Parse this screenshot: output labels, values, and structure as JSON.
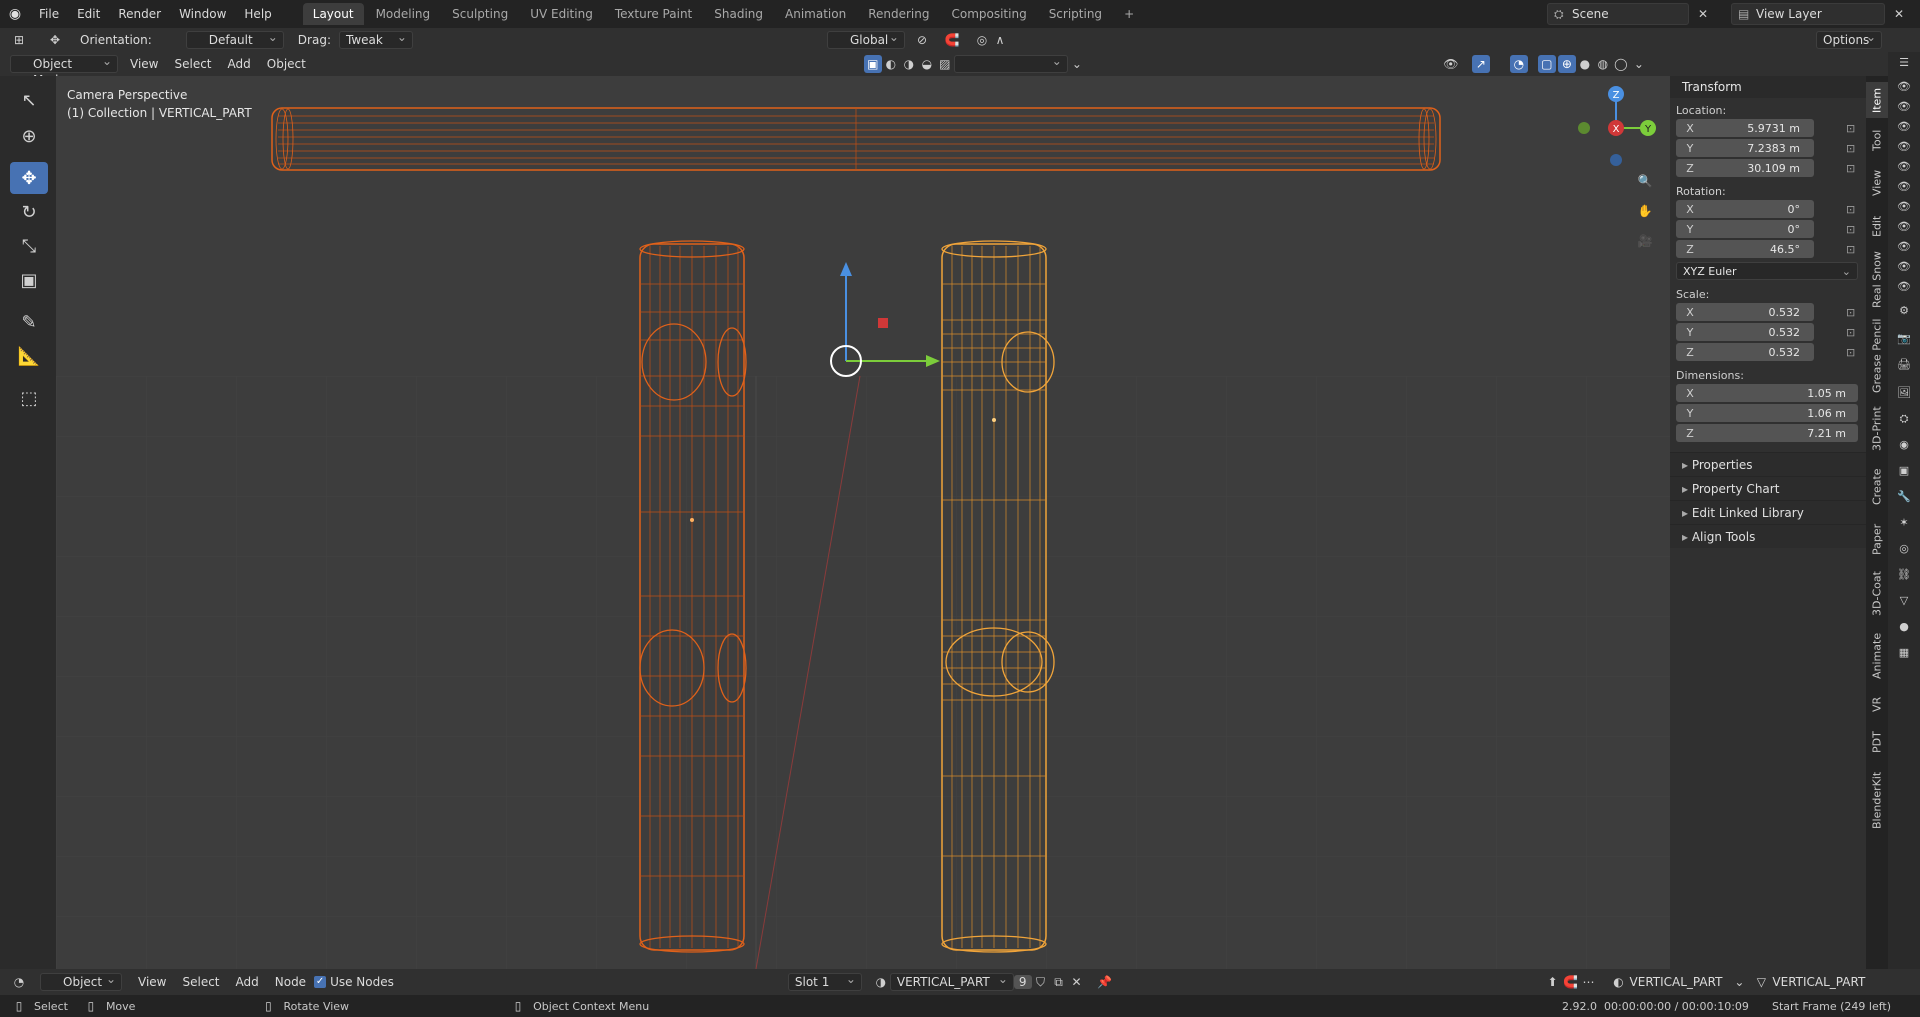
{
  "menu": {
    "file": "File",
    "edit": "Edit",
    "render": "Render",
    "window": "Window",
    "help": "Help"
  },
  "workspaces": [
    "Layout",
    "Modeling",
    "Sculpting",
    "UV Editing",
    "Texture Paint",
    "Shading",
    "Animation",
    "Rendering",
    "Compositing",
    "Scripting"
  ],
  "scene": {
    "name": "Scene",
    "view_layer": "View Layer"
  },
  "tool_header": {
    "orientation_label": "Orientation:",
    "orientation_value": "Default",
    "drag_label": "Drag:",
    "drag_value": "Tweak",
    "transform_orientation": "Global",
    "options": "Options"
  },
  "viewport_header": {
    "mode": "Object Mode",
    "view": "View",
    "select": "Select",
    "add": "Add",
    "object": "Object"
  },
  "viewport": {
    "perspective": "Camera Perspective",
    "collection": "(1) Collection | VERTICAL_PART"
  },
  "npanel": {
    "title": "Transform",
    "location_label": "Location:",
    "location": {
      "x": "5.9731 m",
      "y": "7.2383 m",
      "z": "30.109 m"
    },
    "rotation_label": "Rotation:",
    "rotation": {
      "x": "0°",
      "y": "0°",
      "z": "46.5°"
    },
    "rotation_mode": "XYZ Euler",
    "scale_label": "Scale:",
    "scale": {
      "x": "0.532",
      "y": "0.532",
      "z": "0.532"
    },
    "dimensions_label": "Dimensions:",
    "dimensions": {
      "x": "1.05 m",
      "y": "1.06 m",
      "z": "7.21 m"
    },
    "axis": {
      "x": "X",
      "y": "Y",
      "z": "Z"
    },
    "collapsibles": [
      "Properties",
      "Property Chart",
      "Edit Linked Library",
      "Align Tools"
    ]
  },
  "vtabs": [
    "Item",
    "Tool",
    "View",
    "Edit",
    "Real Snow",
    "Grease Pencil",
    "3D-Print",
    "Create",
    "Paper",
    "3D-Coat",
    "Animate",
    "VR",
    "PDT",
    "BlenderKit"
  ],
  "bottom_header": {
    "editor": "Object",
    "view": "View",
    "select": "Select",
    "add": "Add",
    "node": "Node",
    "use_nodes": "Use Nodes",
    "slot": "Slot 1",
    "material": "VERTICAL_PART",
    "users": "9",
    "object_name": "VERTICAL_PART",
    "object_data": "VERTICAL_PART"
  },
  "status": {
    "select": "Select",
    "move": "Move",
    "rotate": "Rotate View",
    "context": "Object Context Menu",
    "version": "2.92.0",
    "time": "00:00:00:00 / 00:00:10:09",
    "frame": "Start Frame (249 left)"
  },
  "colors": {
    "accent": "#4772b3",
    "selected_orange": "#e0611a",
    "active_orange": "#f0a43a",
    "viewport_bg": "#3d3d3d"
  }
}
